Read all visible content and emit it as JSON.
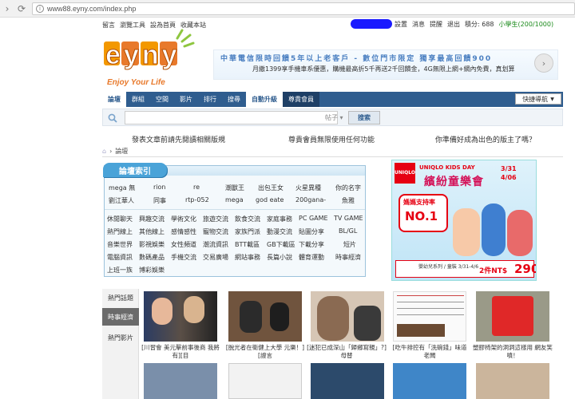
{
  "browser": {
    "url": "www88.eyny.com/index.php"
  },
  "topbar": {
    "links": [
      "留言",
      "瀏覽工具",
      "設為首頁",
      "收藏本站"
    ],
    "user_links": [
      "設置",
      "消息",
      "提醒",
      "退出",
      "積分: 688",
      "小學生(200/1000)"
    ]
  },
  "logo": {
    "text": "eyny",
    "slogan": "Enjoy Your Life"
  },
  "banner": {
    "line1": "中華電信限時回饋5年以上老客戶 - 數位門市限定 獨享最高回饋900",
    "line2": "月繳1399享手機車系優惠，購機最高折5千再送2千回饋金，4G無限上網+網內免費，真划算"
  },
  "mainnav": {
    "items": [
      "論壇",
      "群組",
      "空間",
      "影片",
      "排行",
      "搜尋",
      "自動升級",
      "尊貴會員"
    ],
    "quick": "快捷導航"
  },
  "search": {
    "placeholder": "",
    "scope": "帖子",
    "button": "搜索"
  },
  "notices": [
    "發表文章前請先閱讀相關版規",
    "尊貴會員無限使用任何功能",
    "你準備好成為出色的版主了嗎？"
  ],
  "breadcrumb": [
    "論壇"
  ],
  "forum_index": {
    "title": "論壇索引",
    "row1": [
      "mega 無",
      "rion",
      "re",
      "潮獸王",
      "出包王女",
      "火星異種",
      "你的名字"
    ],
    "row2": [
      "劉江華人",
      "同事",
      "rtp-052",
      "mega",
      "god eate",
      "200gana-",
      "魚雅"
    ],
    "row3": [
      "休閒聊天",
      "興趣交流",
      "學術文化",
      "旅遊交流",
      "飲食交流",
      "家庭事務",
      "PC GAME",
      "TV GAME"
    ],
    "row4": [
      "熱門線上",
      "其他線上",
      "感情感性",
      "寵物交流",
      "家族門派",
      "動漫交流",
      "貼圖分享",
      "BL/GL"
    ],
    "row5": [
      "音樂世界",
      "影視娛樂",
      "女性頻道",
      "潮流資訊",
      "BTT載區",
      "GB下載區",
      "下載分享",
      "短片"
    ],
    "row6": [
      "電腦資訊",
      "數碼產品",
      "手機交流",
      "交易廣場",
      "網站事務",
      "長篇小說",
      "體育運動",
      "時事經濟"
    ],
    "row7": [
      "上班一族",
      "博彩娛樂"
    ]
  },
  "ad": {
    "brand": "UNIQLO",
    "title": "UNIQLO KIDS DAY",
    "headline": "繽紛童樂會",
    "date1": "3/31",
    "date2": "4/06",
    "badge_line1": "媽媽支持率",
    "badge_line2": "NO.1",
    "price_desc": "嬰幼兒系列 / 童裝 3/31-4/6",
    "price_label": "2件NT$",
    "price_amount": "290"
  },
  "side_tabs": [
    "熱門話題",
    "時事經濟",
    "熱門影片"
  ],
  "thumbs": {
    "captions": [
      "[川習會 美元擊前事後商 我將有][目",
      "[脫光者在衛健上大學 元樂！][證言",
      "[迷犯已成深山「歸鄉寫親」?] 母替",
      "[吃牛排控有「洗碗錢」味道 老闆",
      "塑膠椅架的洞洞這樣用 網友笑噴！"
    ]
  }
}
